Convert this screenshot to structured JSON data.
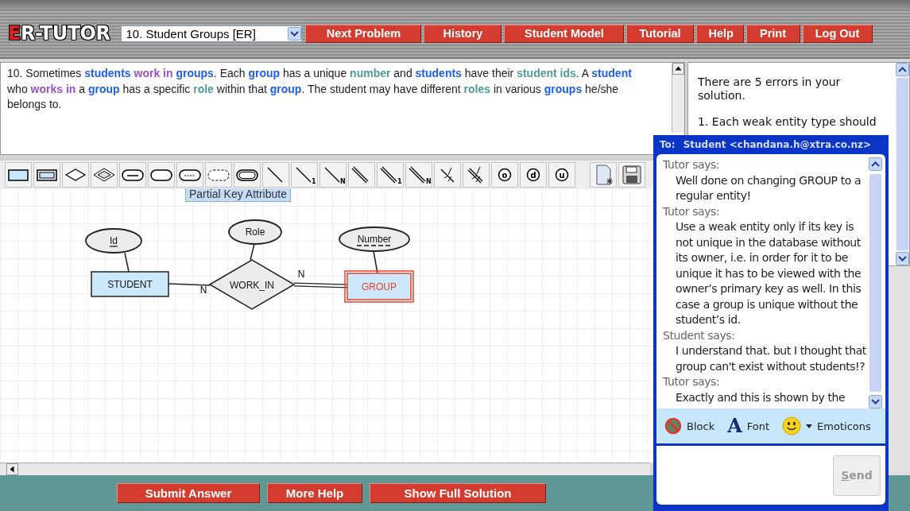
{
  "header": {
    "logo": {
      "initial": "E",
      "rest": "R-TUTOR"
    },
    "problem_select": {
      "value": "10. Student Groups [ER]"
    },
    "nav_buttons": [
      "Next Problem",
      "History",
      "Student Model",
      "Tutorial",
      "Help",
      "Print",
      "Log Out"
    ]
  },
  "problem": {
    "segments": [
      {
        "text": "10. Sometimes ",
        "kind": "plain"
      },
      {
        "text": "students ",
        "kind": "entity"
      },
      {
        "text": "work in ",
        "kind": "relationship"
      },
      {
        "text": "groups",
        "kind": "entity"
      },
      {
        "text": ". Each ",
        "kind": "plain"
      },
      {
        "text": "group",
        "kind": "entity"
      },
      {
        "text": " has a unique ",
        "kind": "plain"
      },
      {
        "text": "number",
        "kind": "attribute"
      },
      {
        "text": " and ",
        "kind": "plain"
      },
      {
        "text": "students",
        "kind": "entity"
      },
      {
        "text": " have their ",
        "kind": "plain"
      },
      {
        "text": "student ids",
        "kind": "attribute"
      },
      {
        "text": ". A ",
        "kind": "plain"
      },
      {
        "text": "student",
        "kind": "entity"
      },
      {
        "text": " who ",
        "kind": "plain"
      },
      {
        "text": "works in",
        "kind": "relationship"
      },
      {
        "text": " a ",
        "kind": "plain"
      },
      {
        "text": "group",
        "kind": "entity"
      },
      {
        "text": " has a specific ",
        "kind": "plain"
      },
      {
        "text": "role",
        "kind": "attribute"
      },
      {
        "text": " within that ",
        "kind": "plain"
      },
      {
        "text": "group",
        "kind": "entity"
      },
      {
        "text": ". The student may have different ",
        "kind": "plain"
      },
      {
        "text": "roles",
        "kind": "attribute"
      },
      {
        "text": " in various ",
        "kind": "plain"
      },
      {
        "text": "groups",
        "kind": "entity"
      },
      {
        "text": " he/she belongs to.",
        "kind": "plain"
      }
    ]
  },
  "feedback": {
    "summary": "There are 5 errors in your solution.",
    "items": [
      "1. Each weak entity type should"
    ]
  },
  "toolbar": {
    "tools": [
      {
        "kind": "entity"
      },
      {
        "kind": "weak-entity"
      },
      {
        "kind": "relationship"
      },
      {
        "kind": "identifying-relationship"
      },
      {
        "kind": "key-attribute"
      },
      {
        "kind": "attribute"
      },
      {
        "kind": "partial-key-attribute"
      },
      {
        "kind": "derived-attribute"
      },
      {
        "kind": "multivalued-attribute"
      },
      {
        "kind": "line"
      },
      {
        "kind": "line",
        "label": "1"
      },
      {
        "kind": "line",
        "label": "N"
      },
      {
        "kind": "double-line"
      },
      {
        "kind": "double-line",
        "label": "1"
      },
      {
        "kind": "double-line",
        "label": "N"
      },
      {
        "kind": "fork"
      },
      {
        "kind": "double-fork"
      },
      {
        "kind": "circle-letter",
        "label": "o"
      },
      {
        "kind": "circle-letter",
        "label": "d"
      },
      {
        "kind": "circle-letter",
        "label": "u"
      },
      {
        "kind": "new-file"
      },
      {
        "kind": "save"
      }
    ],
    "tooltip": "Partial Key Attribute"
  },
  "diagram": {
    "nodes": [
      {
        "kind": "key-attribute",
        "label": "Id",
        "selected": false
      },
      {
        "kind": "attribute",
        "label": "Role",
        "selected": false
      },
      {
        "kind": "partial-key-attribute",
        "label": "Number",
        "selected": false
      },
      {
        "kind": "entity",
        "label": "STUDENT",
        "selected": false
      },
      {
        "kind": "relationship",
        "label": "WORK_IN",
        "selected": false
      },
      {
        "kind": "entity",
        "label": "GROUP",
        "selected": true
      }
    ],
    "edges": [
      {
        "total_participation": false
      },
      {
        "total_participation": false
      },
      {
        "total_participation": false
      },
      {
        "total_participation": false,
        "cardinality": "N"
      },
      {
        "total_participation": true,
        "cardinality": "N"
      }
    ]
  },
  "bottom_buttons": [
    "Submit Answer",
    "More Help",
    "Show Full Solution"
  ],
  "chat": {
    "to_label": "To:",
    "recipient": "Student <chandana.h@xtra.co.nz>",
    "messages": [
      {
        "speaker": "Tutor says:",
        "text": "Well done on changing GROUP to a regular entity!"
      },
      {
        "speaker": "Tutor says:",
        "text": "Use a weak entity only if its key is not unique in the database without its owner, i.e. in order for it to be unique it has to be viewed with the owner’s primary key as well. In this case a group is unique without the student’s id."
      },
      {
        "speaker": "Student says:",
        "text": "I understand that. but I thought that group can't exist without students!?"
      },
      {
        "speaker": "Tutor says:",
        "text": "Exactly and this is shown by the"
      }
    ],
    "tools": [
      {
        "kind": "block",
        "label": "Block"
      },
      {
        "kind": "font",
        "glyph": "A",
        "label": "Font"
      },
      {
        "kind": "emoticons",
        "label": "Emoticons"
      }
    ],
    "send_button": {
      "label": "Send",
      "disabled": true
    }
  }
}
